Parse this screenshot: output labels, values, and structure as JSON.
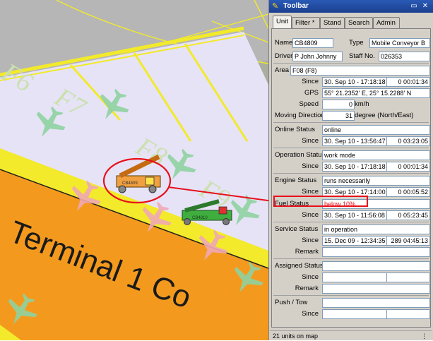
{
  "window": {
    "title": "Toolbar",
    "minimize_glyph": "▭",
    "close_glyph": "✕"
  },
  "tabs": [
    {
      "label": "Unit"
    },
    {
      "label": "Filter *"
    },
    {
      "label": "Stand"
    },
    {
      "label": "Search"
    },
    {
      "label": "Admin"
    }
  ],
  "unit": {
    "name_label": "Name",
    "name_value": "CB4809",
    "type_label": "Type",
    "type_value": "Mobile Conveyor B",
    "driver_label": "Driver",
    "driver_value": "P John Johnny",
    "staff_label": "Staff No.",
    "staff_value": "026353",
    "area_label": "Area",
    "area_value": "F08 (F8)",
    "since_label": "Since",
    "area_since": "30. Sep 10  -  17:18:18",
    "area_duration": "0 00:01:34",
    "gps_label": "GPS",
    "gps_value": "55° 21.2352' E, 25° 15.2288' N",
    "speed_label": "Speed",
    "speed_value": "0",
    "speed_unit": "km/h",
    "direction_label": "Moving Direction",
    "direction_value": "31",
    "direction_unit": "degree (North/East)",
    "online_label": "Online Status",
    "online_value": "online",
    "online_since": "30. Sep 10  -  13:56:47",
    "online_duration": "0 03:23:05",
    "operation_label": "Operation Status",
    "operation_value": "work mode",
    "operation_since": "30. Sep 10  -  17:18:18",
    "operation_duration": "0 00:01:34",
    "engine_label": "Engine Status",
    "engine_value": "runs necessarily",
    "engine_since": "30. Sep 10  -  17:14:00",
    "engine_duration": "0 00:05:52",
    "fuel_label": "Fuel Status",
    "fuel_value": "below  10%",
    "fuel_since": "30. Sep 10  -  11:56:08",
    "fuel_duration": "0 05:23:45",
    "service_label": "Service Status",
    "service_value": "in operation",
    "service_since": "15. Dec 09  -  12:34:35",
    "service_duration": "289 04:45:13",
    "remark_label": "Remark",
    "assigned_label": "Assigned Status",
    "push_label": "Push / Tow"
  },
  "status_bar": {
    "text": "21 units on map"
  },
  "map": {
    "gate_labels": [
      "F6",
      "F7",
      "F8",
      "F9"
    ],
    "terminal_label": "Terminal 1 Co",
    "vehicle_orange_tag": "CB4809",
    "vehicle_green_tag": "CB4810"
  },
  "colors": {
    "highlight_red": "#e8101a",
    "apron": "#e6e3f7",
    "terminal_orange": "#f39a1e",
    "stripe_yellow": "#f2ea2a",
    "tarmac": "#b6b6b6",
    "map_bg": "#adb2a6",
    "vehicle_orange": "#f0a040",
    "vehicle_green": "#3fae3f"
  }
}
